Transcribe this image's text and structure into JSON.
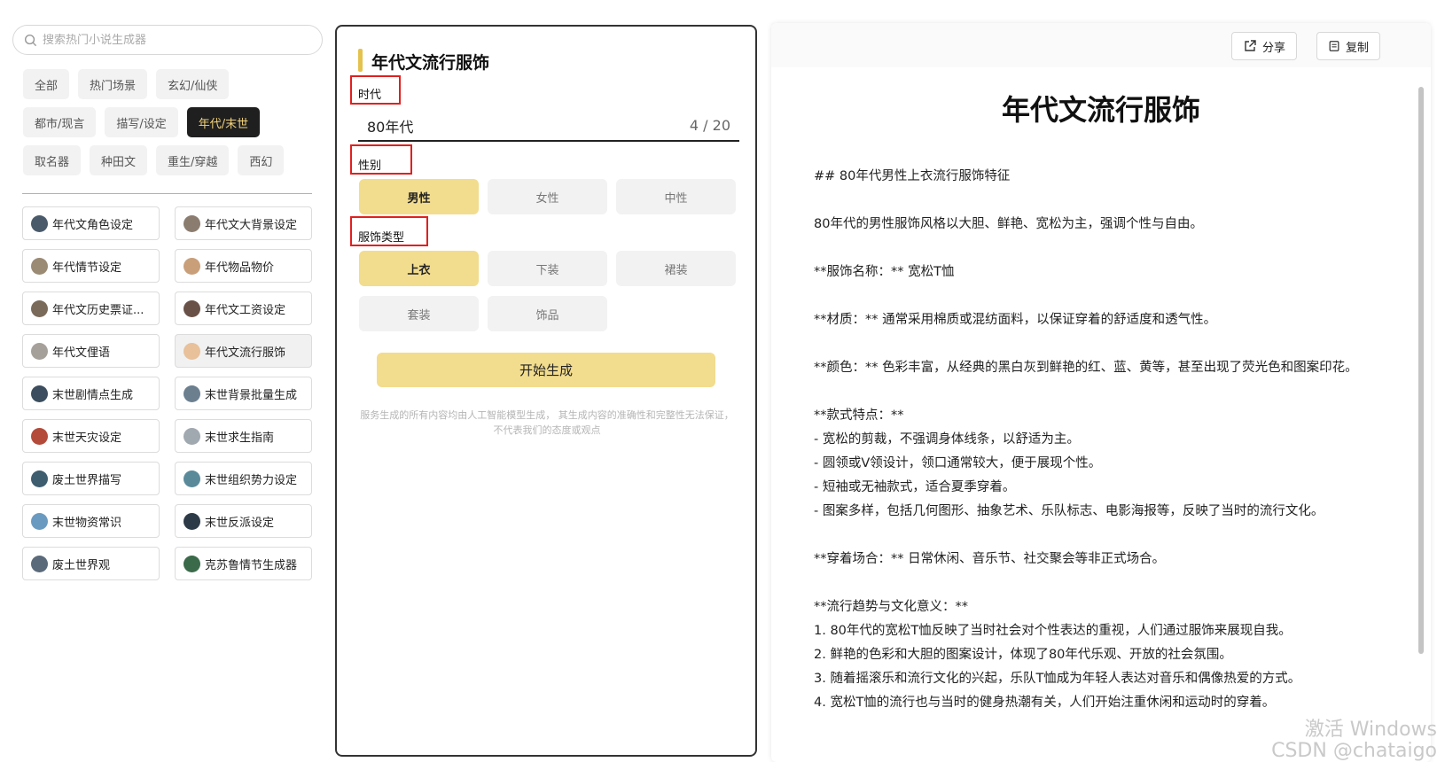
{
  "search": {
    "placeholder": "搜索热门小说生成器"
  },
  "categories": [
    [
      "全部",
      "热门场景",
      "玄幻/仙侠"
    ],
    [
      "都市/现言",
      "描写/设定",
      "年代/末世"
    ],
    [
      "取名器",
      "种田文",
      "重生/穿越",
      "西幻"
    ]
  ],
  "active_category": "年代/末世",
  "generators": [
    [
      "年代文角色设定",
      "年代文大背景设定"
    ],
    [
      "年代情节设定",
      "年代物品物价"
    ],
    [
      "年代文历史票证...",
      "年代文工资设定"
    ],
    [
      "年代文俚语",
      "年代文流行服饰"
    ],
    [
      "末世剧情点生成",
      "末世背景批量生成"
    ],
    [
      "末世天灾设定",
      "末世求生指南"
    ],
    [
      "废土世界描写",
      "末世组织势力设定"
    ],
    [
      "末世物资常识",
      "末世反派设定"
    ],
    [
      "废土世界观",
      "克苏鲁情节生成器"
    ]
  ],
  "active_generator": "年代文流行服饰",
  "form": {
    "title": "年代文流行服饰",
    "era_label": "时代",
    "era_value": "80年代",
    "era_count": "4 / 20",
    "gender_label": "性别",
    "gender_options": [
      "男性",
      "女性",
      "中性"
    ],
    "gender_selected": "男性",
    "type_label": "服饰类型",
    "type_options_row1": [
      "上衣",
      "下装",
      "裙装"
    ],
    "type_options_row2": [
      "套装",
      "饰品"
    ],
    "type_selected": "上衣",
    "generate_label": "开始生成",
    "disclaimer": "服务生成的所有内容均由人工智能模型生成， 其生成内容的准确性和完整性无法保证， 不代表我们的态度或观点"
  },
  "output": {
    "share_label": "分享",
    "copy_label": "复制",
    "title": "年代文流行服饰",
    "lines": [
      "## 80年代男性上衣流行服饰特征",
      "",
      "80年代的男性服饰风格以大胆、鲜艳、宽松为主，强调个性与自由。",
      "",
      "**服饰名称：** 宽松T恤",
      "",
      "**材质：** 通常采用棉质或混纺面料，以保证穿着的舒适度和透气性。",
      "",
      "**颜色：** 色彩丰富，从经典的黑白灰到鲜艳的红、蓝、黄等，甚至出现了荧光色和图案印花。",
      "",
      "**款式特点：**",
      "- 宽松的剪裁，不强调身体线条，以舒适为主。",
      "- 圆领或V领设计，领口通常较大，便于展现个性。",
      "- 短袖或无袖款式，适合夏季穿着。",
      "- 图案多样，包括几何图形、抽象艺术、乐队标志、电影海报等，反映了当时的流行文化。",
      "",
      "**穿着场合：** 日常休闲、音乐节、社交聚会等非正式场合。",
      "",
      "**流行趋势与文化意义：**",
      "1. 80年代的宽松T恤反映了当时社会对个性表达的重视，人们通过服饰来展现自我。",
      "2. 鲜艳的色彩和大胆的图案设计，体现了80年代乐观、开放的社会氛围。",
      "3. 随着摇滚乐和流行文化的兴起，乐队T恤成为年轻人表达对音乐和偶像热爱的方式。",
      "4. 宽松T恤的流行也与当时的健身热潮有关，人们开始注重休闲和运动时的穿着。"
    ]
  },
  "watermark": {
    "line1": "激活 Windows",
    "line2": "CSDN @chataigo"
  },
  "colors": {
    "accent": "#f2dc8e",
    "title_bar": "#e4c24e",
    "highlight_box": "#e02020",
    "active_dark": "#1f1f1f"
  }
}
